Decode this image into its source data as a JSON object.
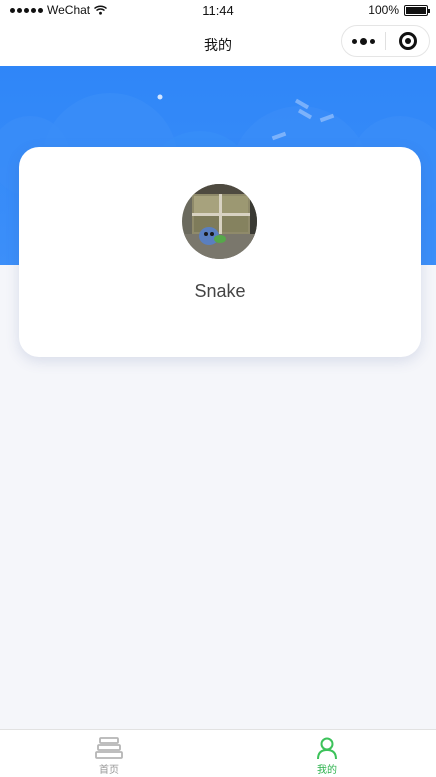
{
  "status_bar": {
    "carrier": "WeChat",
    "time": "11:44",
    "battery": "100%"
  },
  "nav": {
    "title": "我的"
  },
  "profile": {
    "username": "Snake"
  },
  "tab_bar": {
    "items": [
      {
        "label": "首页",
        "icon": "home-books-icon",
        "active": false
      },
      {
        "label": "我的",
        "icon": "user-icon",
        "active": true
      }
    ]
  },
  "colors": {
    "header_blue": "#2f86f8",
    "active_tab": "#2bb24c",
    "inactive_tab": "#999999",
    "page_bg": "#f5f6fa"
  }
}
